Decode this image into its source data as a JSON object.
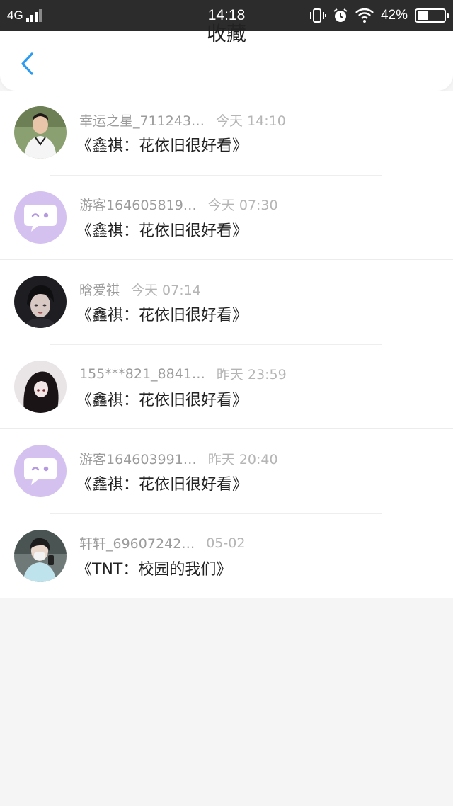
{
  "status_bar": {
    "network": "4G",
    "time": "14:18",
    "battery_text": "42%",
    "battery_level": 0.42
  },
  "header": {
    "title": "收藏",
    "back_icon": "chevron-left-icon",
    "accent": "#2b9cf2"
  },
  "favorites": [
    {
      "user": "幸运之星_711243…",
      "time": "今天 14:10",
      "title": "《鑫祺：花依旧很好看》",
      "avatar": "photo-boy-white-shirt"
    },
    {
      "user": "游客164605819…",
      "time": "今天 07:30",
      "title": "《鑫祺：花依旧很好看》",
      "avatar": "guest-chat-icon"
    },
    {
      "user": "晗爱祺",
      "time": "今天 07:14",
      "title": "《鑫祺：花依旧很好看》",
      "avatar": "photo-dark-portrait"
    },
    {
      "user": "155***821_8841…",
      "time": "昨天 23:59",
      "title": "《鑫祺：花依旧很好看》",
      "avatar": "photo-hooded-anime"
    },
    {
      "user": "游客164603991…",
      "time": "昨天 20:40",
      "title": "《鑫祺：花依旧很好看》",
      "avatar": "guest-chat-icon"
    },
    {
      "user": "轩轩_69607242…",
      "time": "05-02",
      "title": "《TNT：校园的我们》",
      "avatar": "photo-masked-person"
    }
  ]
}
